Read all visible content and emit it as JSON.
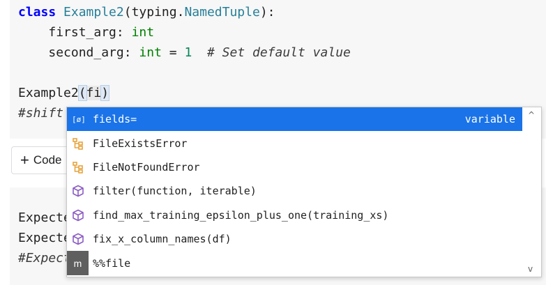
{
  "cell1": {
    "line1": {
      "kw": "class",
      "name": "Example2",
      "open": "(typing.",
      "base": "NamedTuple",
      "close": "):"
    },
    "line2": {
      "indent": "    ",
      "field": "first_arg: ",
      "type": "int"
    },
    "line3": {
      "indent": "    ",
      "field": "second_arg: ",
      "type": "int",
      "eq": " = ",
      "num": "1",
      "gap": "  ",
      "comment": "# Set default value"
    },
    "line5": {
      "pre": "Example2",
      "open": "(",
      "word": "fi",
      "close": ")"
    },
    "line6": {
      "comment": "#shift"
    }
  },
  "add_code_button": {
    "plus": "+",
    "label": "Code"
  },
  "cell2": {
    "line1": "Expected",
    "line2": "Expected",
    "line3": "#Expected"
  },
  "autocomplete": {
    "items": [
      {
        "icon": "variable-icon",
        "label": "fields=",
        "kind": "variable",
        "selected": true
      },
      {
        "icon": "class-icon",
        "label": "FileExistsError"
      },
      {
        "icon": "class-icon",
        "label": "FileNotFoundError"
      },
      {
        "icon": "function-icon",
        "label": "filter(function, iterable)"
      },
      {
        "icon": "function-icon",
        "label": "find_max_training_epsilon_plus_one(training_xs)"
      },
      {
        "icon": "function-icon",
        "label": "fix_x_column_names(df)"
      },
      {
        "icon": "magic-icon",
        "icon_text": "m",
        "label": "%%file"
      }
    ],
    "scroll_up": "^",
    "scroll_down": "v"
  },
  "colors": {
    "selection": "#1a73e8",
    "class_icon": "#e8a33d",
    "function_icon": "#8b5cc4",
    "cell_bg": "#f7f7f7"
  }
}
